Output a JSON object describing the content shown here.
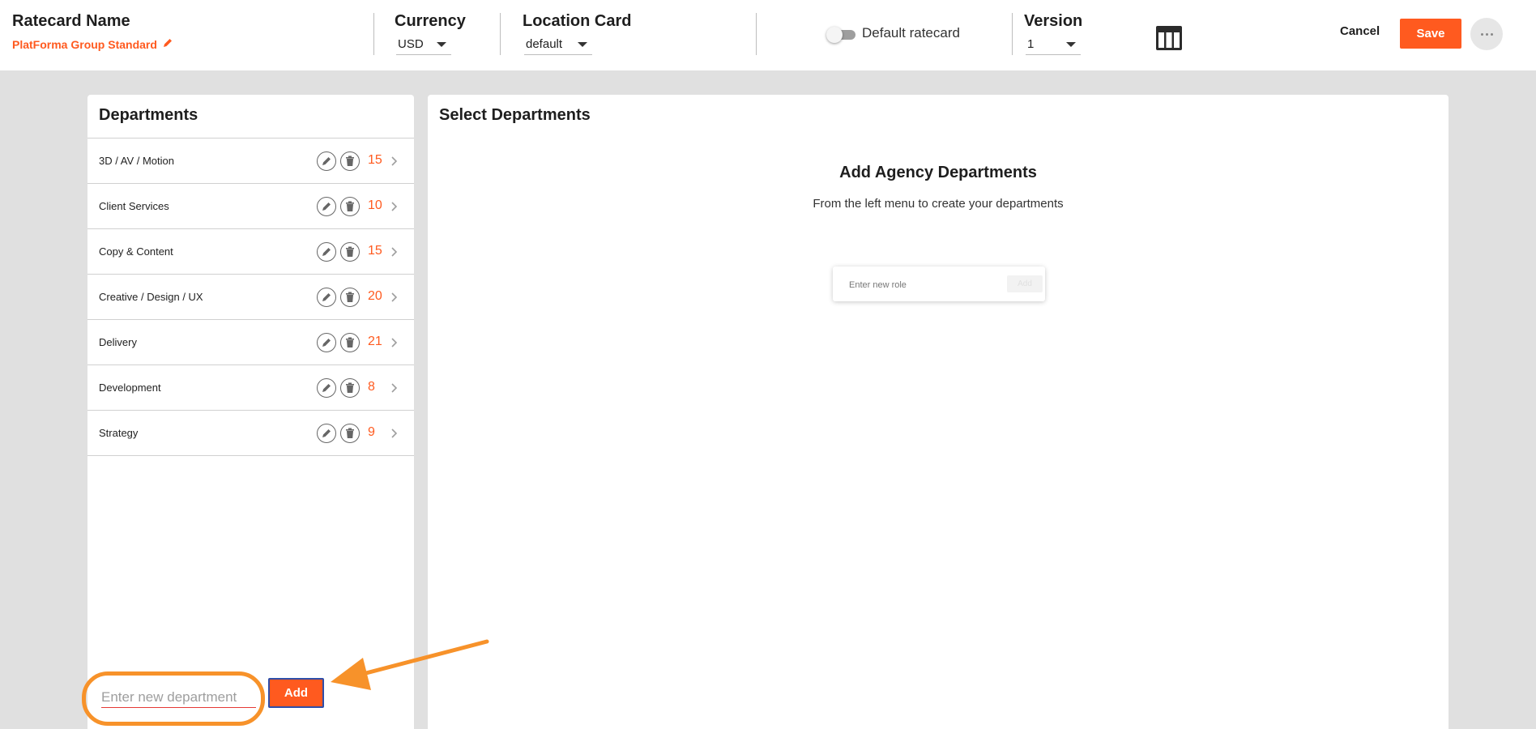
{
  "header": {
    "ratecard_name_label": "Ratecard Name",
    "ratecard_name_value": "PlatForma Group Standard",
    "currency_label": "Currency",
    "currency_value": "USD",
    "location_label": "Location Card",
    "location_value": "default",
    "default_toggle_label": "Default ratecard",
    "default_toggle_on": false,
    "version_label": "Version",
    "version_value": "1",
    "cancel_label": "Cancel",
    "save_label": "Save"
  },
  "departments_panel": {
    "title": "Departments",
    "items": [
      {
        "name": "3D / AV / Motion",
        "count": "15"
      },
      {
        "name": "Client Services",
        "count": "10"
      },
      {
        "name": "Copy & Content",
        "count": "15"
      },
      {
        "name": "Creative / Design / UX",
        "count": "20"
      },
      {
        "name": "Delivery",
        "count": "21"
      },
      {
        "name": "Development",
        "count": "8"
      },
      {
        "name": "Strategy",
        "count": "9"
      }
    ],
    "new_department_placeholder": "Enter new department",
    "add_label": "Add"
  },
  "select_panel": {
    "title": "Select Departments",
    "empty_title": "Add Agency Departments",
    "empty_subtitle": "From the left menu to create your departments",
    "role_placeholder": "Enter new role",
    "role_add_label": "Add"
  },
  "colors": {
    "accent": "#ff5a1f",
    "annotation": "#f7922a",
    "focus_border": "#2f4ea8"
  }
}
